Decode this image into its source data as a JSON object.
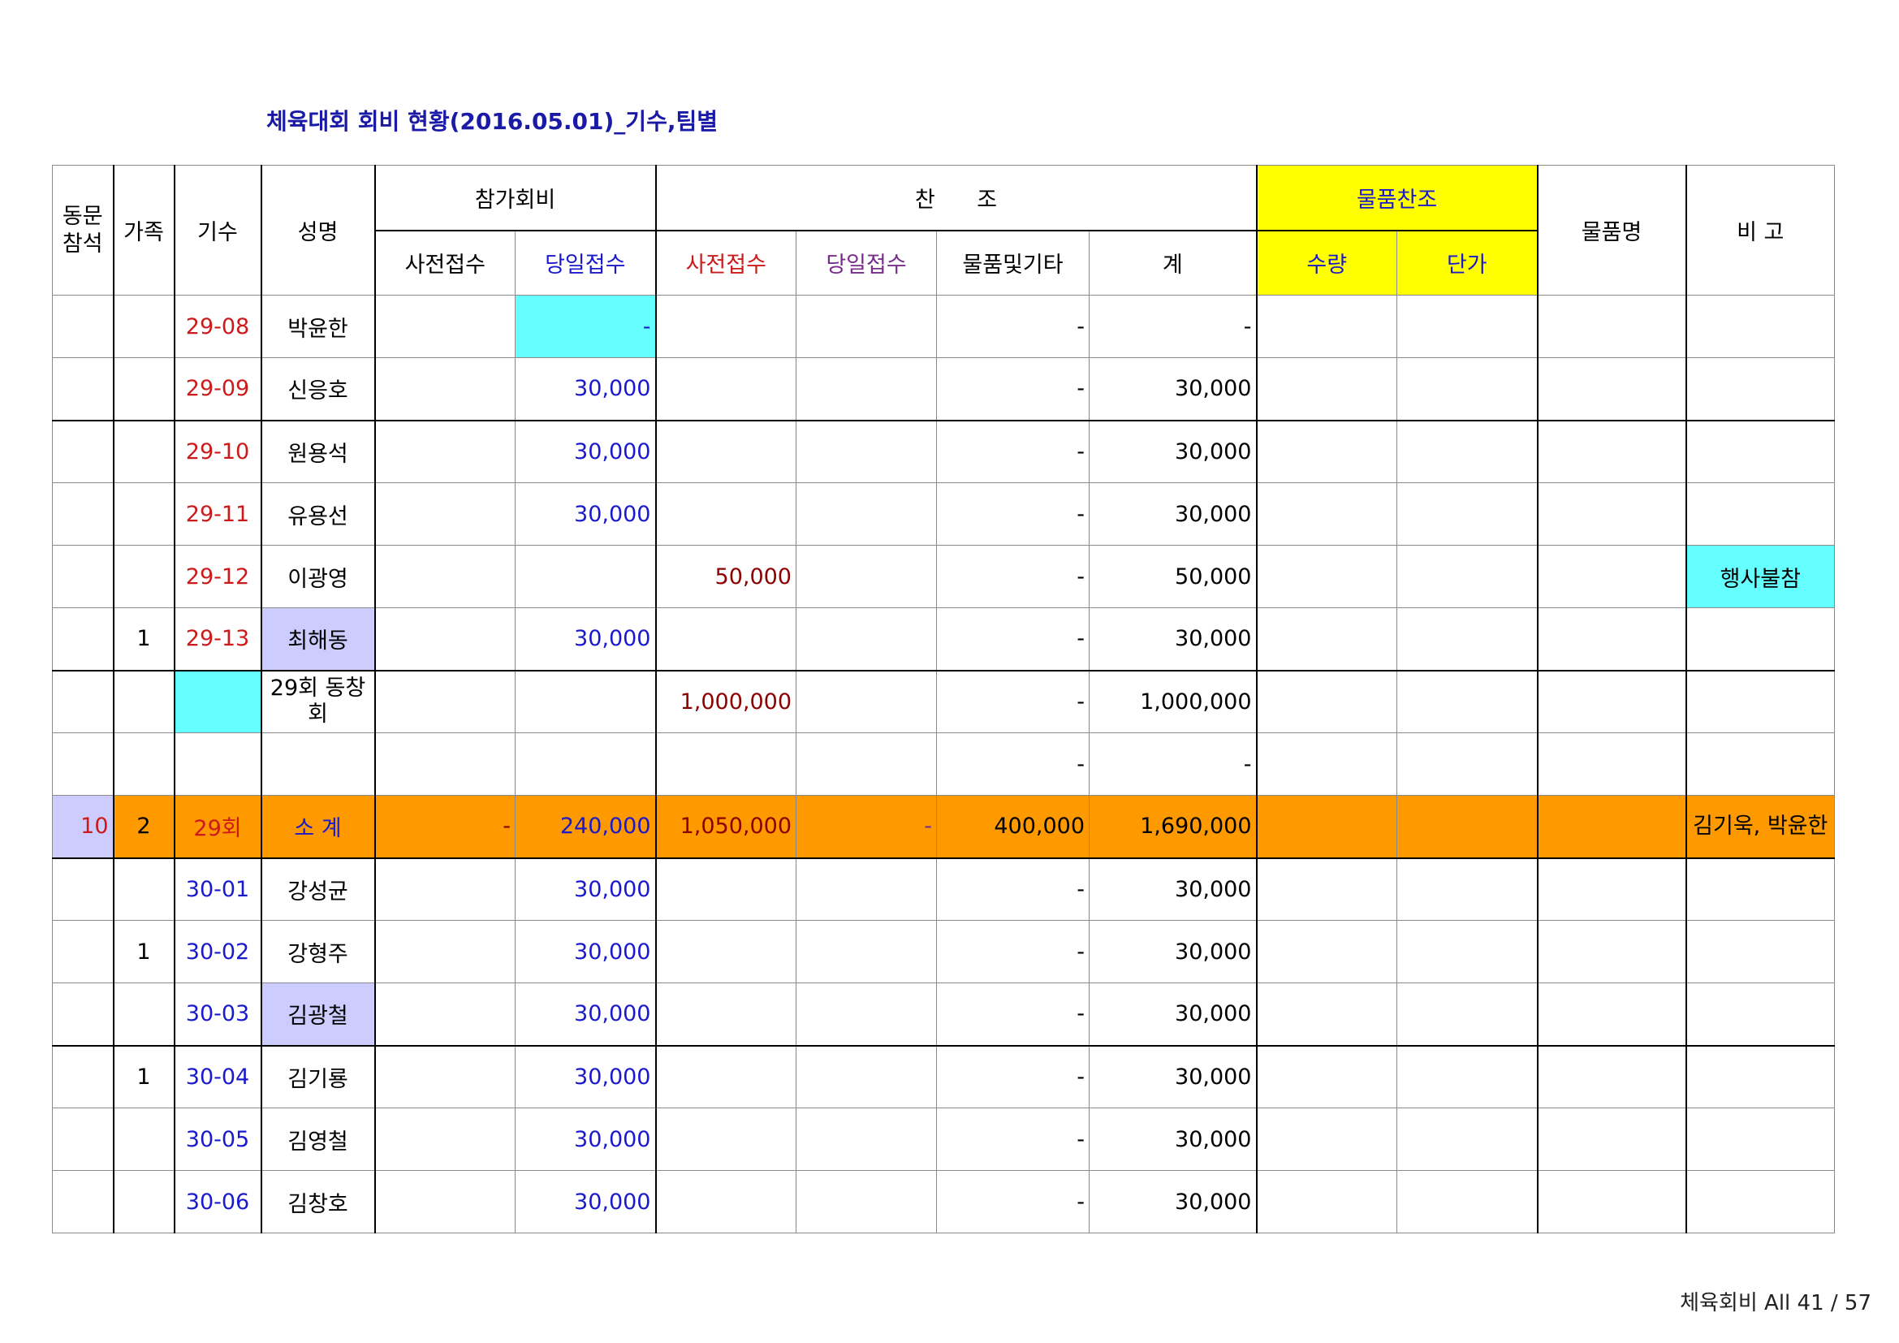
{
  "title": "체육대회 회비 현황(2016.05.01)_기수,팀별",
  "headers": {
    "attend": "동문\n참석",
    "family": "가족",
    "cohort": "기수",
    "name": "성명",
    "fee_group": "참가회비",
    "support_group": "찬      조",
    "goods_group": "물품찬조",
    "goods_name": "물품명",
    "remarks": "비 고",
    "fee_pre": "사전접수",
    "fee_day": "당일접수",
    "sup_pre": "사전접수",
    "sup_day": "당일접수",
    "sup_goods": "물품및기타",
    "total": "계",
    "qty": "수량",
    "price": "단가"
  },
  "rows": [
    {
      "attend": "",
      "family": "",
      "cohort": "29-08",
      "name": "박윤한",
      "fee_pre": "",
      "fee_day": "-",
      "sup_pre": "",
      "sup_day": "",
      "sup_goods": "-",
      "total": "-",
      "qty": "",
      "price": "",
      "goods_name": "",
      "remarks": ""
    },
    {
      "attend": "",
      "family": "",
      "cohort": "29-09",
      "name": "신응호",
      "fee_pre": "",
      "fee_day": "30,000",
      "sup_pre": "",
      "sup_day": "",
      "sup_goods": "-",
      "total": "30,000",
      "qty": "",
      "price": "",
      "goods_name": "",
      "remarks": ""
    },
    {
      "attend": "",
      "family": "",
      "cohort": "29-10",
      "name": "원용석",
      "fee_pre": "",
      "fee_day": "30,000",
      "sup_pre": "",
      "sup_day": "",
      "sup_goods": "-",
      "total": "30,000",
      "qty": "",
      "price": "",
      "goods_name": "",
      "remarks": ""
    },
    {
      "attend": "",
      "family": "",
      "cohort": "29-11",
      "name": "유용선",
      "fee_pre": "",
      "fee_day": "30,000",
      "sup_pre": "",
      "sup_day": "",
      "sup_goods": "-",
      "total": "30,000",
      "qty": "",
      "price": "",
      "goods_name": "",
      "remarks": ""
    },
    {
      "attend": "",
      "family": "",
      "cohort": "29-12",
      "name": "이광영",
      "fee_pre": "",
      "fee_day": "",
      "sup_pre": "50,000",
      "sup_day": "",
      "sup_goods": "-",
      "total": "50,000",
      "qty": "",
      "price": "",
      "goods_name": "",
      "remarks": "행사불참"
    },
    {
      "attend": "",
      "family": "1",
      "cohort": "29-13",
      "name": "최해동",
      "fee_pre": "",
      "fee_day": "30,000",
      "sup_pre": "",
      "sup_day": "",
      "sup_goods": "-",
      "total": "30,000",
      "qty": "",
      "price": "",
      "goods_name": "",
      "remarks": ""
    },
    {
      "attend": "",
      "family": "",
      "cohort": "",
      "name": "29회\n동창회",
      "fee_pre": "",
      "fee_day": "",
      "sup_pre": "1,000,000",
      "sup_day": "",
      "sup_goods": "-",
      "total": "1,000,000",
      "qty": "",
      "price": "",
      "goods_name": "",
      "remarks": ""
    },
    {
      "attend": "",
      "family": "",
      "cohort": "",
      "name": "",
      "fee_pre": "",
      "fee_day": "",
      "sup_pre": "",
      "sup_day": "",
      "sup_goods": "-",
      "total": "-",
      "qty": "",
      "price": "",
      "goods_name": "",
      "remarks": ""
    },
    {
      "attend": "10",
      "family": "2",
      "cohort": "29회",
      "name": "소   계",
      "fee_pre": "-",
      "fee_day": "240,000",
      "sup_pre": "1,050,000",
      "sup_day": "-",
      "sup_goods": "400,000",
      "total": "1,690,000",
      "qty": "",
      "price": "",
      "goods_name": "",
      "remarks": "김기욱,\n박윤한"
    },
    {
      "attend": "",
      "family": "",
      "cohort": "30-01",
      "name": "강성균",
      "fee_pre": "",
      "fee_day": "30,000",
      "sup_pre": "",
      "sup_day": "",
      "sup_goods": "-",
      "total": "30,000",
      "qty": "",
      "price": "",
      "goods_name": "",
      "remarks": ""
    },
    {
      "attend": "",
      "family": "1",
      "cohort": "30-02",
      "name": "강형주",
      "fee_pre": "",
      "fee_day": "30,000",
      "sup_pre": "",
      "sup_day": "",
      "sup_goods": "-",
      "total": "30,000",
      "qty": "",
      "price": "",
      "goods_name": "",
      "remarks": ""
    },
    {
      "attend": "",
      "family": "",
      "cohort": "30-03",
      "name": "김광철",
      "fee_pre": "",
      "fee_day": "30,000",
      "sup_pre": "",
      "sup_day": "",
      "sup_goods": "-",
      "total": "30,000",
      "qty": "",
      "price": "",
      "goods_name": "",
      "remarks": ""
    },
    {
      "attend": "",
      "family": "1",
      "cohort": "30-04",
      "name": "김기룡",
      "fee_pre": "",
      "fee_day": "30,000",
      "sup_pre": "",
      "sup_day": "",
      "sup_goods": "-",
      "total": "30,000",
      "qty": "",
      "price": "",
      "goods_name": "",
      "remarks": ""
    },
    {
      "attend": "",
      "family": "",
      "cohort": "30-05",
      "name": "김영철",
      "fee_pre": "",
      "fee_day": "30,000",
      "sup_pre": "",
      "sup_day": "",
      "sup_goods": "-",
      "total": "30,000",
      "qty": "",
      "price": "",
      "goods_name": "",
      "remarks": ""
    },
    {
      "attend": "",
      "family": "",
      "cohort": "30-06",
      "name": "김창호",
      "fee_pre": "",
      "fee_day": "30,000",
      "sup_pre": "",
      "sup_day": "",
      "sup_goods": "-",
      "total": "30,000",
      "qty": "",
      "price": "",
      "goods_name": "",
      "remarks": ""
    }
  ],
  "footer": "체육회비 All 41 / 57",
  "colors": {
    "title": "#1a1aa6",
    "cohort_29": "#cc1a1a",
    "cohort_30": "#1a1acc",
    "fee_day_header": "#1a1acc",
    "sup_pre_header": "#cc1a1a",
    "sup_day_header": "#7a2c8c",
    "goods_header_bg": "#ffff00",
    "highlight_cyan": "#66ffff",
    "highlight_lavender": "#ccccff",
    "subtotal_bg": "#ff9900"
  }
}
